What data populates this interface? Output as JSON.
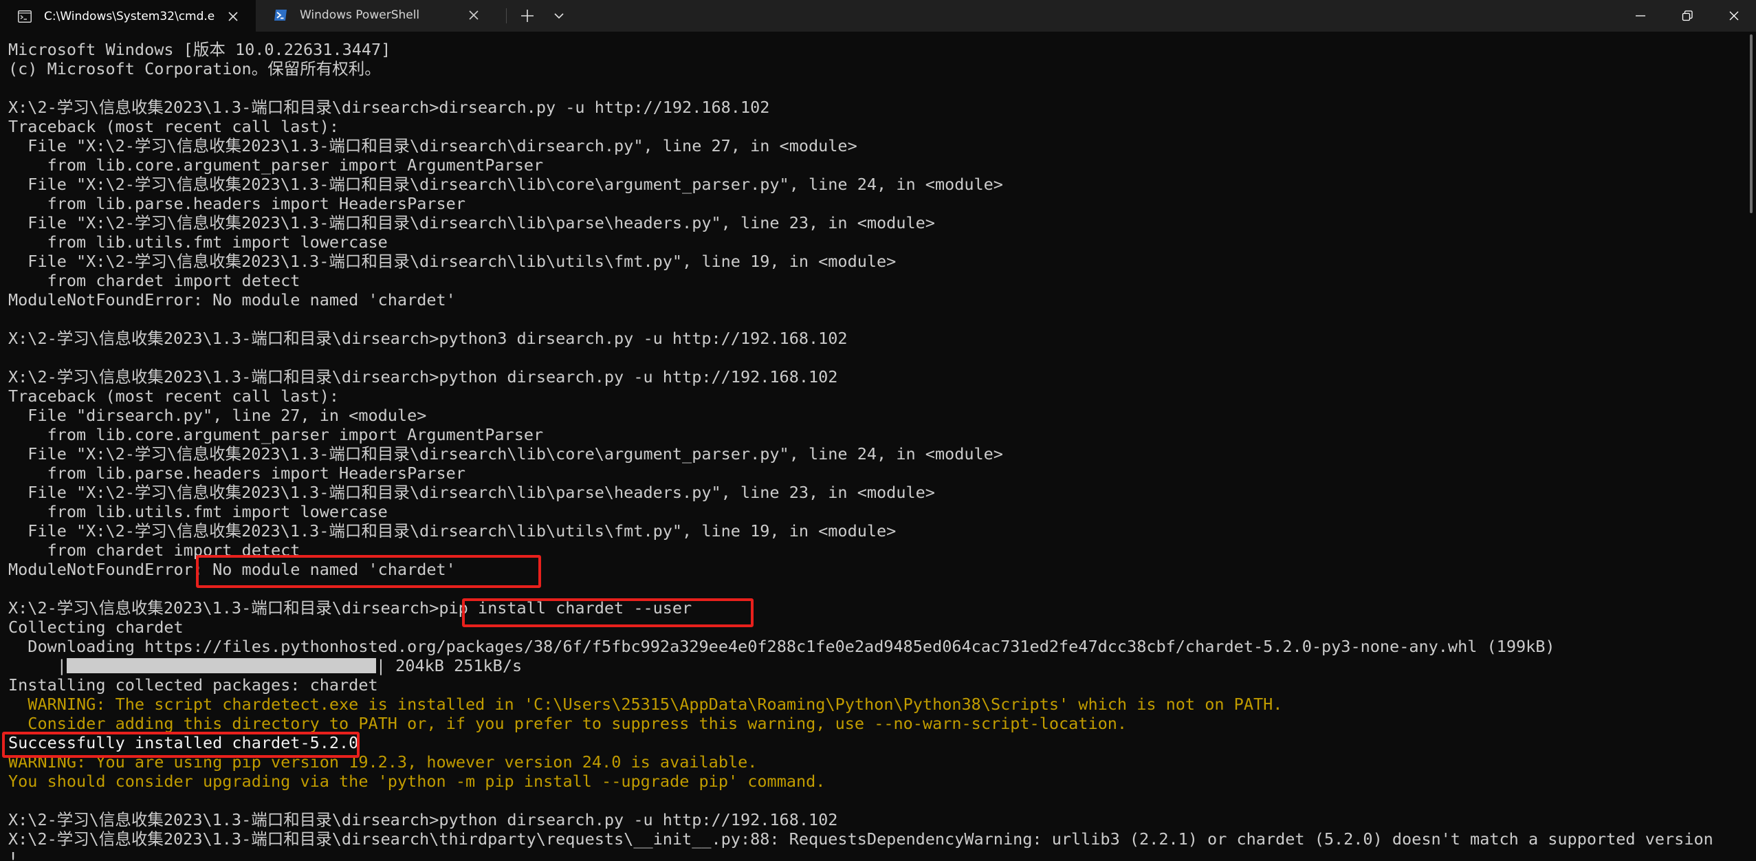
{
  "tabs": [
    {
      "title": "C:\\Windows\\System32\\cmd.e",
      "icon": "cmd-icon",
      "active": true
    },
    {
      "title": "Windows PowerShell",
      "icon": "powershell-icon",
      "active": false
    }
  ],
  "terminal": {
    "lines": [
      {
        "text": "Microsoft Windows [版本 10.0.22631.3447]"
      },
      {
        "text": "(c) Microsoft Corporation。保留所有权利。"
      },
      {
        "text": ""
      },
      {
        "text": "X:\\2-学习\\信息收集2023\\1.3-端口和目录\\dirsearch>dirsearch.py -u http://192.168.102"
      },
      {
        "text": "Traceback (most recent call last):"
      },
      {
        "text": "  File \"X:\\2-学习\\信息收集2023\\1.3-端口和目录\\dirsearch\\dirsearch.py\", line 27, in <module>"
      },
      {
        "text": "    from lib.core.argument_parser import ArgumentParser"
      },
      {
        "text": "  File \"X:\\2-学习\\信息收集2023\\1.3-端口和目录\\dirsearch\\lib\\core\\argument_parser.py\", line 24, in <module>"
      },
      {
        "text": "    from lib.parse.headers import HeadersParser"
      },
      {
        "text": "  File \"X:\\2-学习\\信息收集2023\\1.3-端口和目录\\dirsearch\\lib\\parse\\headers.py\", line 23, in <module>"
      },
      {
        "text": "    from lib.utils.fmt import lowercase"
      },
      {
        "text": "  File \"X:\\2-学习\\信息收集2023\\1.3-端口和目录\\dirsearch\\lib\\utils\\fmt.py\", line 19, in <module>"
      },
      {
        "text": "    from chardet import detect"
      },
      {
        "text": "ModuleNotFoundError: No module named 'chardet'"
      },
      {
        "text": ""
      },
      {
        "text": "X:\\2-学习\\信息收集2023\\1.3-端口和目录\\dirsearch>python3 dirsearch.py -u http://192.168.102"
      },
      {
        "text": ""
      },
      {
        "text": "X:\\2-学习\\信息收集2023\\1.3-端口和目录\\dirsearch>python dirsearch.py -u http://192.168.102"
      },
      {
        "text": "Traceback (most recent call last):"
      },
      {
        "text": "  File \"dirsearch.py\", line 27, in <module>"
      },
      {
        "text": "    from lib.core.argument_parser import ArgumentParser"
      },
      {
        "text": "  File \"X:\\2-学习\\信息收集2023\\1.3-端口和目录\\dirsearch\\lib\\core\\argument_parser.py\", line 24, in <module>"
      },
      {
        "text": "    from lib.parse.headers import HeadersParser"
      },
      {
        "text": "  File \"X:\\2-学习\\信息收集2023\\1.3-端口和目录\\dirsearch\\lib\\parse\\headers.py\", line 23, in <module>"
      },
      {
        "text": "    from lib.utils.fmt import lowercase"
      },
      {
        "text": "  File \"X:\\2-学习\\信息收集2023\\1.3-端口和目录\\dirsearch\\lib\\utils\\fmt.py\", line 19, in <module>"
      },
      {
        "text": "    from chardet import detect"
      },
      {
        "text": "ModuleNotFoundError: No module named 'chardet'"
      },
      {
        "text": ""
      },
      {
        "text": "X:\\2-学习\\信息收集2023\\1.3-端口和目录\\dirsearch>pip install chardet --user"
      },
      {
        "text": "Collecting chardet"
      },
      {
        "text": "  Downloading https://files.pythonhosted.org/packages/38/6f/f5fbc992a329ee4e0f288c1fe0e2ad9485ed064cac731ed2fe47dcc38cbf/chardet-5.2.0-py3-none-any.whl (199kB)"
      },
      {
        "text": ""
      },
      {
        "text": "Installing collected packages: chardet"
      },
      {
        "text": "  WARNING: The script chardetect.exe is installed in 'C:\\Users\\25315\\AppData\\Roaming\\Python\\Python38\\Scripts' which is not on PATH."
      },
      {
        "text": "  Consider adding this directory to PATH or, if you prefer to suppress this warning, use --no-warn-script-location."
      },
      {
        "text": "Successfully installed chardet-5.2.0"
      },
      {
        "text": "WARNING: You are using pip version 19.2.3, however version 24.0 is available."
      },
      {
        "text": "You should consider upgrading via the 'python -m pip install --upgrade pip' command."
      },
      {
        "text": ""
      },
      {
        "text": "X:\\2-学习\\信息收集2023\\1.3-端口和目录\\dirsearch>python dirsearch.py -u http://192.168.102"
      },
      {
        "text": "X:\\2-学习\\信息收集2023\\1.3-端口和目录\\dirsearch\\thirdparty\\requests\\__init__.py:88: RequestsDependencyWarning: urllib3 (2.2.1) or chardet (5.2.0) doesn't match a supported version"
      },
      {
        "text": "!"
      }
    ],
    "progress": {
      "indent": "     |",
      "fraction": 1.0,
      "suffix": "| 204kB 251kB/s"
    }
  },
  "colors": {
    "background": "#0c0c0c",
    "foreground": "#cccccc",
    "warning": "#c19c00",
    "annotation": "#e8201c",
    "titlebar": "#202020"
  }
}
